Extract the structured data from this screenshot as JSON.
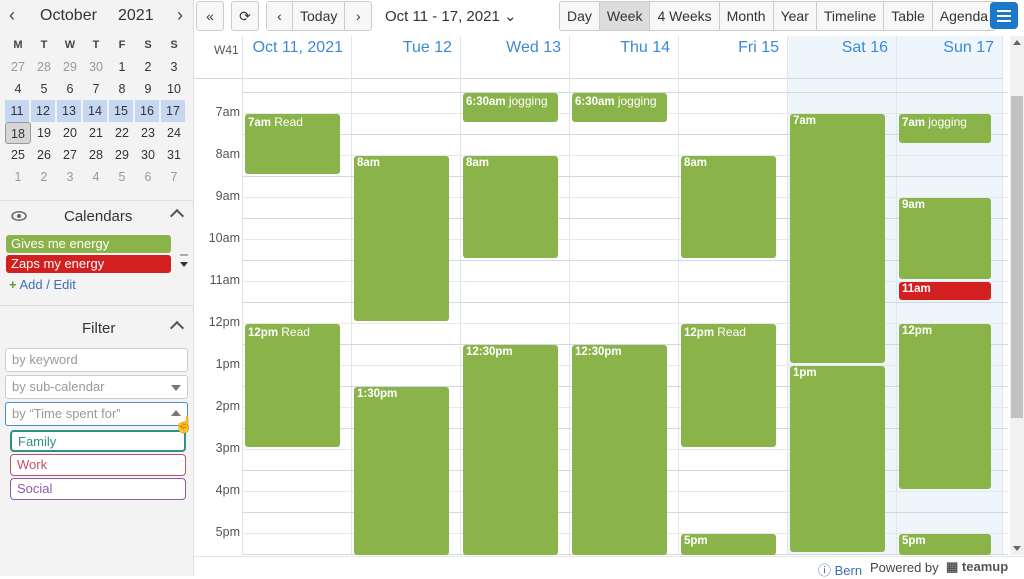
{
  "minical": {
    "month": "October",
    "year": "2021",
    "dow": [
      "M",
      "T",
      "W",
      "T",
      "F",
      "S",
      "S"
    ],
    "weeks": [
      [
        "27",
        "28",
        "29",
        "30",
        "1",
        "2",
        "3"
      ],
      [
        "4",
        "5",
        "6",
        "7",
        "8",
        "9",
        "10"
      ],
      [
        "11",
        "12",
        "13",
        "14",
        "15",
        "16",
        "17"
      ],
      [
        "18",
        "19",
        "20",
        "21",
        "22",
        "23",
        "24"
      ],
      [
        "25",
        "26",
        "27",
        "28",
        "29",
        "30",
        "31"
      ],
      [
        "1",
        "2",
        "3",
        "4",
        "5",
        "6",
        "7"
      ]
    ]
  },
  "calendars": {
    "title": "Calendars",
    "items": [
      {
        "label": "Gives me energy",
        "color": "#8ab34a"
      },
      {
        "label": "Zaps my energy",
        "color": "#d21f1f"
      }
    ],
    "add_edit": "Add / Edit"
  },
  "filter": {
    "title": "Filter",
    "keyword_placeholder": "by keyword",
    "subcal_placeholder": "by sub-calendar",
    "time_placeholder": "by “Time spent for”",
    "options": [
      {
        "label": "Family",
        "color": "#2e8f86"
      },
      {
        "label": "Work",
        "color": "#c94a6a"
      },
      {
        "label": "Social",
        "color": "#8a5ab0"
      }
    ]
  },
  "toolbar": {
    "today": "Today",
    "range": "Oct 11 - 17, 2021",
    "views": [
      "Day",
      "Week",
      "4 Weeks",
      "Month",
      "Year",
      "Timeline",
      "Table",
      "Agenda"
    ],
    "selected_view": "Week"
  },
  "grid": {
    "week_no": "W41",
    "days": [
      "Oct 11, 2021",
      "Tue 12",
      "Wed 13",
      "Thu 14",
      "Fri 15",
      "Sat 16",
      "Sun 17"
    ],
    "hours": [
      "7am",
      "8am",
      "9am",
      "10am",
      "11am",
      "12pm",
      "1pm",
      "2pm",
      "3pm",
      "4pm",
      "5pm"
    ]
  },
  "events": [
    {
      "day": 0,
      "start": 7.0,
      "end": 8.5,
      "time": "7am",
      "title": "Read",
      "color": "#8ab34a"
    },
    {
      "day": 0,
      "start": 12.0,
      "end": 15.0,
      "time": "12pm",
      "title": "Read",
      "color": "#8ab34a"
    },
    {
      "day": 1,
      "start": 8.0,
      "end": 12.0,
      "time": "8am",
      "title": "",
      "color": "#8ab34a"
    },
    {
      "day": 1,
      "start": 13.5,
      "end": 18.0,
      "time": "1:30pm",
      "title": "",
      "color": "#8ab34a"
    },
    {
      "day": 2,
      "start": 6.5,
      "end": 7.25,
      "time": "6:30am",
      "title": "jogging",
      "color": "#8ab34a"
    },
    {
      "day": 2,
      "start": 8.0,
      "end": 10.5,
      "time": "8am",
      "title": "",
      "color": "#8ab34a"
    },
    {
      "day": 2,
      "start": 12.5,
      "end": 17.75,
      "time": "12:30pm",
      "title": "",
      "color": "#8ab34a"
    },
    {
      "day": 3,
      "start": 6.5,
      "end": 7.25,
      "time": "6:30am",
      "title": "jogging",
      "color": "#8ab34a"
    },
    {
      "day": 3,
      "start": 12.5,
      "end": 18.0,
      "time": "12:30pm",
      "title": "",
      "color": "#8ab34a"
    },
    {
      "day": 4,
      "start": 8.0,
      "end": 10.5,
      "time": "8am",
      "title": "",
      "color": "#8ab34a"
    },
    {
      "day": 4,
      "start": 12.0,
      "end": 15.0,
      "time": "12pm",
      "title": "Read",
      "color": "#8ab34a"
    },
    {
      "day": 4,
      "start": 17.0,
      "end": 18.0,
      "time": "5pm",
      "title": "",
      "color": "#8ab34a"
    },
    {
      "day": 5,
      "start": 7.0,
      "end": 13.0,
      "time": "7am",
      "title": "",
      "color": "#8ab34a"
    },
    {
      "day": 5,
      "start": 13.0,
      "end": 17.5,
      "time": "1pm",
      "title": "",
      "color": "#8ab34a"
    },
    {
      "day": 6,
      "start": 7.0,
      "end": 7.75,
      "time": "7am",
      "title": "jogging",
      "color": "#8ab34a"
    },
    {
      "day": 6,
      "start": 9.0,
      "end": 11.0,
      "time": "9am",
      "title": "",
      "color": "#8ab34a"
    },
    {
      "day": 6,
      "start": 11.0,
      "end": 11.5,
      "time": "11am",
      "title": "",
      "color": "#d21f1f"
    },
    {
      "day": 6,
      "start": 12.0,
      "end": 16.0,
      "time": "12pm",
      "title": "",
      "color": "#8ab34a"
    },
    {
      "day": 6,
      "start": 17.0,
      "end": 18.0,
      "time": "5pm",
      "title": "",
      "color": "#8ab34a"
    }
  ],
  "footer": {
    "timezone": "Bern",
    "powered_by": "Powered by",
    "brand": "teamup"
  }
}
